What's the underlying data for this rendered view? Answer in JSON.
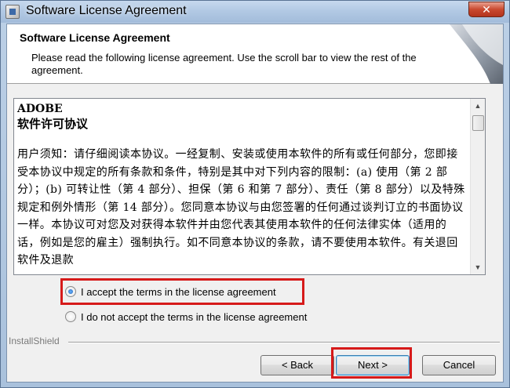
{
  "window": {
    "title": "Software License Agreement",
    "close_glyph": "✕"
  },
  "header": {
    "title": "Software License Agreement",
    "description": "Please read the following license agreement.  Use the scroll bar to view the rest of the agreement."
  },
  "license": {
    "company": "ADOBE",
    "heading": "软件许可协议",
    "body": "用户须知：请仔细阅读本协议。一经复制、安装或使用本软件的所有或任何部分，您即接受本协议中规定的所有条款和条件，特别是其中对下列内容的限制：(a) 使用（第 2 部分）；(b) 可转让性（第 4 部分）、担保（第 6 和第 7 部分）、责任（第 8 部分）以及特殊规定和例外情形（第 14 部分）。您同意本协议与由您签署的任何通过谈判订立的书面协议一样。本协议可对您及对获得本软件并由您代表其使用本软件的任何法律实体（适用的话，例如是您的雇主）强制执行。如不同意本协议的条款，请不要使用本软件。有关退回软件及退款"
  },
  "options": {
    "accept_label": "I accept the terms in the license agreement",
    "decline_label": "I do not accept the terms in the license agreement",
    "selected": "accept"
  },
  "footer": {
    "brand": "InstallShield"
  },
  "buttons": {
    "back": "< Back",
    "next": "Next >",
    "cancel": "Cancel"
  },
  "colors": {
    "highlight": "#d61a1a",
    "title_gradient_top": "#c7d9ee"
  },
  "icons": {
    "app": "installer-icon",
    "close": "close-icon",
    "scroll_up": "scroll-up-arrow-icon",
    "scroll_down": "scroll-down-arrow-icon"
  }
}
